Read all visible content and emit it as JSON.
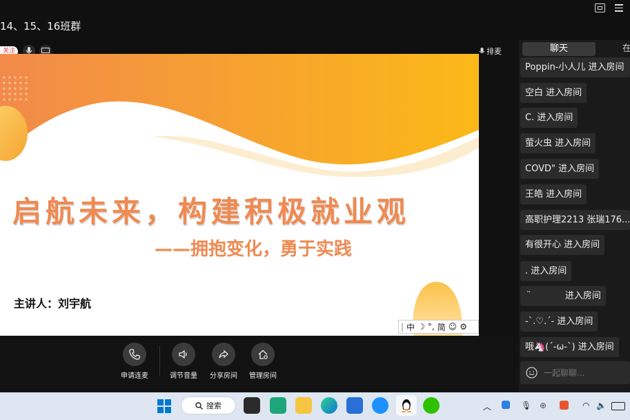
{
  "window": {
    "group_title": "14、15、16班群"
  },
  "video": {
    "follow_badge": "关注",
    "queue_label": "排麦"
  },
  "slide": {
    "title": "启航未来，构建积极就业观",
    "subtitle": "——拥抱变化，勇于实践",
    "speaker": "主讲人：刘宇航"
  },
  "ime": {
    "items": [
      "中",
      "☽",
      "°,",
      "简",
      "☺",
      "⚙"
    ]
  },
  "controls": [
    {
      "label": "申请连麦",
      "icon": "phone-icon"
    },
    {
      "label": "调节音量",
      "icon": "speaker-icon"
    },
    {
      "label": "分享房间",
      "icon": "share-icon"
    },
    {
      "label": "管理房间",
      "icon": "home-gear-icon"
    }
  ],
  "chat": {
    "tabs": [
      "聊天",
      "在"
    ],
    "messages": [
      "Poppin-小人儿 进入房间",
      "空白 进入房间",
      "C. 进入房间",
      "萤火虫 进入房间",
      "COVD\" 进入房间",
      "王皓 进入房间",
      "高职护理2213 张瑞176...",
      "有很开心 进入房间",
      ". 进入房间",
      "  ̈            进入房间",
      "-`.♡.´- 进入房间",
      "哦🦄(´-ω-`) 进入房间"
    ],
    "input_placeholder": "一起聊聊..."
  },
  "taskbar": {
    "search_label": "搜索",
    "colors": {
      "accent": "#0078d4",
      "brand_orange": "#f7941d"
    }
  }
}
